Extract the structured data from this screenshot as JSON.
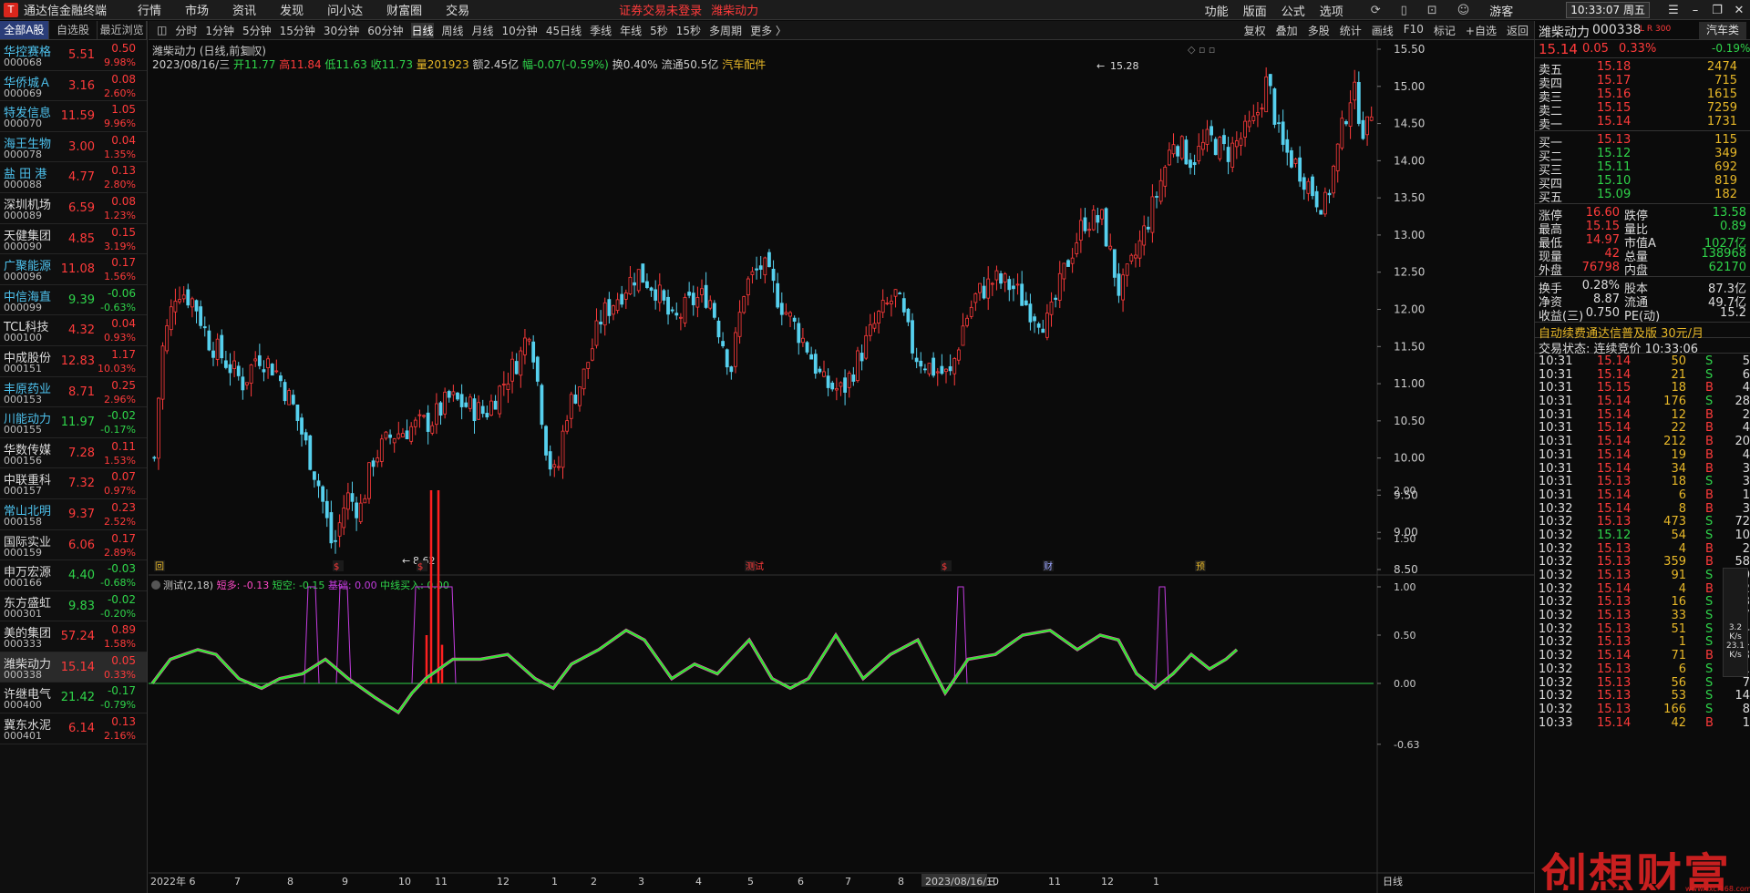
{
  "topbar": {
    "app": "通达信金融终端",
    "menus": [
      "行情",
      "市场",
      "资讯",
      "发现",
      "问小达",
      "财富圈",
      "交易"
    ],
    "warn": "证券交易未登录",
    "warn2": "潍柴动力",
    "right_menus": [
      "功能",
      "版面",
      "公式",
      "选项"
    ],
    "guest": "游客",
    "clock": "10:33:07 周五"
  },
  "left": {
    "tabs": [
      "全部A股",
      "自选股",
      "最近浏览"
    ],
    "rows": [
      {
        "name": "华控赛格",
        "code": "000068",
        "price": "5.51",
        "chg": "0.50",
        "pct": "9.98%",
        "dir": "up",
        "cls": "cy"
      },
      {
        "name": "华侨城Ａ",
        "code": "000069",
        "price": "3.16",
        "chg": "0.08",
        "pct": "2.60%",
        "dir": "up",
        "cls": "cy"
      },
      {
        "name": "特发信息",
        "code": "000070",
        "price": "11.59",
        "chg": "1.05",
        "pct": "9.96%",
        "dir": "up",
        "cls": "cy"
      },
      {
        "name": "海王生物",
        "code": "000078",
        "price": "3.00",
        "chg": "0.04",
        "pct": "1.35%",
        "dir": "up",
        "cls": "cy"
      },
      {
        "name": "盐 田 港",
        "code": "000088",
        "price": "4.77",
        "chg": "0.13",
        "pct": "2.80%",
        "dir": "up",
        "cls": "cy"
      },
      {
        "name": "深圳机场",
        "code": "000089",
        "price": "6.59",
        "chg": "0.08",
        "pct": "1.23%",
        "dir": "up",
        "cls": "wt"
      },
      {
        "name": "天健集团",
        "code": "000090",
        "price": "4.85",
        "chg": "0.15",
        "pct": "3.19%",
        "dir": "up",
        "cls": "wt"
      },
      {
        "name": "广聚能源",
        "code": "000096",
        "price": "11.08",
        "chg": "0.17",
        "pct": "1.56%",
        "dir": "up",
        "cls": "cy"
      },
      {
        "name": "中信海直",
        "code": "000099",
        "price": "9.39",
        "chg": "-0.06",
        "pct": "-0.63%",
        "dir": "dn",
        "cls": "cy"
      },
      {
        "name": "TCL科技",
        "code": "000100",
        "price": "4.32",
        "chg": "0.04",
        "pct": "0.93%",
        "dir": "up",
        "cls": "wt"
      },
      {
        "name": "中成股份",
        "code": "000151",
        "price": "12.83",
        "chg": "1.17",
        "pct": "10.03%",
        "dir": "up",
        "cls": "wt"
      },
      {
        "name": "丰原药业",
        "code": "000153",
        "price": "8.71",
        "chg": "0.25",
        "pct": "2.96%",
        "dir": "up",
        "cls": "cy"
      },
      {
        "name": "川能动力",
        "code": "000155",
        "price": "11.97",
        "chg": "-0.02",
        "pct": "-0.17%",
        "dir": "dn",
        "cls": "cy"
      },
      {
        "name": "华数传媒",
        "code": "000156",
        "price": "7.28",
        "chg": "0.11",
        "pct": "1.53%",
        "dir": "up",
        "cls": "wt"
      },
      {
        "name": "中联重科",
        "code": "000157",
        "price": "7.32",
        "chg": "0.07",
        "pct": "0.97%",
        "dir": "up",
        "cls": "wt"
      },
      {
        "name": "常山北明",
        "code": "000158",
        "price": "9.37",
        "chg": "0.23",
        "pct": "2.52%",
        "dir": "up",
        "cls": "cy"
      },
      {
        "name": "国际实业",
        "code": "000159",
        "price": "6.06",
        "chg": "0.17",
        "pct": "2.89%",
        "dir": "up",
        "cls": "wt"
      },
      {
        "name": "申万宏源",
        "code": "000166",
        "price": "4.40",
        "chg": "-0.03",
        "pct": "-0.68%",
        "dir": "dn",
        "cls": "wt"
      },
      {
        "name": "东方盛虹",
        "code": "000301",
        "price": "9.83",
        "chg": "-0.02",
        "pct": "-0.20%",
        "dir": "dn",
        "cls": "wt"
      },
      {
        "name": "美的集团",
        "code": "000333",
        "price": "57.24",
        "chg": "0.89",
        "pct": "1.58%",
        "dir": "up",
        "cls": "wt"
      },
      {
        "name": "潍柴动力",
        "code": "000338",
        "price": "15.14",
        "chg": "0.05",
        "pct": "0.33%",
        "dir": "up",
        "cls": "wt",
        "sel": true
      },
      {
        "name": "许继电气",
        "code": "000400",
        "price": "21.42",
        "chg": "-0.17",
        "pct": "-0.79%",
        "dir": "dn",
        "cls": "wt"
      },
      {
        "name": "冀东水泥",
        "code": "000401",
        "price": "6.14",
        "chg": "0.13",
        "pct": "2.16%",
        "dir": "up",
        "cls": "wt"
      }
    ]
  },
  "toolbar": {
    "periods": [
      "分时",
      "1分钟",
      "5分钟",
      "15分钟",
      "30分钟",
      "60分钟",
      "日线",
      "周线",
      "月线",
      "10分钟",
      "45日线",
      "季线",
      "年线",
      "5秒",
      "15秒",
      "多周期",
      "更多 〉"
    ],
    "active": "日线",
    "right": [
      "复权",
      "叠加",
      "多股",
      "统计",
      "画线",
      "F10",
      "标记",
      "+自选",
      "返回"
    ]
  },
  "chart": {
    "title": "潍柴动力 (日线,前复权)",
    "info": {
      "date": "2023/08/16/三",
      "open": "开11.77",
      "high": "高11.84",
      "low": "低11.63",
      "close": "收11.73",
      "vol": "量201923",
      "amt": "额2.45亿",
      "chg": "幅-0.07(-0.59%)",
      "turn": "换0.40%",
      "float": "流通50.5亿",
      "sector": "汽车配件"
    },
    "max_label": "15.28",
    "min_label": "8.62",
    "price_ticks": [
      "15.50",
      "15.00",
      "14.50",
      "14.00",
      "13.50",
      "13.00",
      "12.50",
      "12.00",
      "11.50",
      "11.00",
      "10.50",
      "10.00",
      "9.50",
      "9.00",
      "8.50"
    ],
    "ind_title": "测试(2,18)",
    "ind_vals": [
      {
        "t": "短多: -0.13",
        "c": "#ff4ac8"
      },
      {
        "t": "短空: -0.15",
        "c": "#2fd44a"
      },
      {
        "t": "基础: 0.00",
        "c": "#c43ce0"
      },
      {
        "t": "中线买入: 0.00",
        "c": "#2fd44a"
      }
    ],
    "ind_ticks": [
      "2.00",
      "1.50",
      "1.00",
      "0.50",
      "0.00",
      "-0.63"
    ],
    "x_labels": [
      "2022年 6",
      "7",
      "8",
      "9",
      "10",
      "11",
      "12",
      "1",
      "2",
      "3",
      "4",
      "5",
      "6",
      "7",
      "8",
      "2023/08/16/三",
      "10",
      "11",
      "12",
      "1",
      "日线"
    ],
    "markers": [
      "回",
      "$",
      "$",
      "测试",
      "$",
      "财",
      "预"
    ]
  },
  "rp": {
    "name": "潍柴动力",
    "code": "000338",
    "lr": "L R 300",
    "sector": "汽车类",
    "sector_pct": "-0.19%",
    "price": "15.14",
    "chg": "0.05",
    "pct": "0.33%",
    "asks": [
      {
        "l": "卖五",
        "p": "15.18",
        "v": "2474"
      },
      {
        "l": "卖四",
        "p": "15.17",
        "v": "715"
      },
      {
        "l": "卖三",
        "p": "15.16",
        "v": "1615"
      },
      {
        "l": "卖二",
        "p": "15.15",
        "v": "7259"
      },
      {
        "l": "卖一",
        "p": "15.14",
        "v": "1731"
      }
    ],
    "bids": [
      {
        "l": "买一",
        "p": "15.13",
        "v": "115"
      },
      {
        "l": "买二",
        "p": "15.12",
        "v": "349"
      },
      {
        "l": "买三",
        "p": "15.11",
        "v": "692"
      },
      {
        "l": "买四",
        "p": "15.10",
        "v": "819"
      },
      {
        "l": "买五",
        "p": "15.09",
        "v": "182"
      }
    ],
    "stats": [
      [
        "涨停",
        "16.60",
        "跌停",
        "13.58"
      ],
      [
        "最高",
        "15.15",
        "量比",
        "0.89"
      ],
      [
        "最低",
        "14.97",
        "市值A",
        "1027亿"
      ],
      [
        "现量",
        "42",
        "总量",
        "138968"
      ],
      [
        "外盘",
        "76798",
        "内盘",
        "62170"
      ]
    ],
    "stats2": [
      [
        "换手",
        "0.28%",
        "股本",
        "87.3亿"
      ],
      [
        "净资",
        "8.87",
        "流通",
        "49.7亿"
      ],
      [
        "收益(三)",
        "0.750",
        "PE(动)",
        "15.2"
      ]
    ],
    "ad": "自动续费通达信普及版  30元/月",
    "state": "交易状态: 连续竞价  10:33:06",
    "ticks": [
      [
        "10:31",
        "15.14",
        "50",
        "S",
        "5"
      ],
      [
        "10:31",
        "15.14",
        "21",
        "S",
        "6"
      ],
      [
        "10:31",
        "15.15",
        "18",
        "B",
        "4"
      ],
      [
        "10:31",
        "15.14",
        "176",
        "S",
        "28"
      ],
      [
        "10:31",
        "15.14",
        "12",
        "B",
        "2"
      ],
      [
        "10:31",
        "15.14",
        "22",
        "B",
        "4"
      ],
      [
        "10:31",
        "15.14",
        "212",
        "B",
        "20"
      ],
      [
        "10:31",
        "15.14",
        "19",
        "B",
        "4"
      ],
      [
        "10:31",
        "15.14",
        "34",
        "B",
        "3"
      ],
      [
        "10:31",
        "15.13",
        "18",
        "S",
        "3"
      ],
      [
        "10:31",
        "15.14",
        "6",
        "B",
        "1"
      ],
      [
        "10:32",
        "15.14",
        "8",
        "B",
        "3"
      ],
      [
        "10:32",
        "15.13",
        "473",
        "S",
        "72"
      ],
      [
        "10:32",
        "15.12",
        "54",
        "S",
        "10"
      ],
      [
        "10:32",
        "15.13",
        "4",
        "B",
        "2"
      ],
      [
        "10:32",
        "15.13",
        "359",
        "B",
        "58"
      ],
      [
        "10:32",
        "15.13",
        "91",
        "S",
        "10"
      ],
      [
        "10:32",
        "15.14",
        "4",
        "B",
        "2"
      ],
      [
        "10:32",
        "15.13",
        "16",
        "S",
        "3"
      ],
      [
        "10:32",
        "15.13",
        "33",
        "S",
        "7"
      ],
      [
        "10:32",
        "15.13",
        "51",
        "S",
        "4"
      ],
      [
        "10:32",
        "15.13",
        "1",
        "S",
        "1"
      ],
      [
        "10:32",
        "15.14",
        "71",
        "B",
        "3"
      ],
      [
        "10:32",
        "15.13",
        "6",
        "S",
        "1"
      ],
      [
        "10:32",
        "15.13",
        "56",
        "S",
        "7"
      ],
      [
        "10:32",
        "15.13",
        "53",
        "S",
        "14"
      ],
      [
        "10:32",
        "15.13",
        "166",
        "S",
        "8"
      ],
      [
        "10:33",
        "15.14",
        "42",
        "B",
        "1"
      ]
    ],
    "side": [
      "3.2",
      "K/s",
      "23.1",
      "K/s"
    ],
    "watermark": "创想财富",
    "wm_site": "www.cxcf168.com"
  }
}
